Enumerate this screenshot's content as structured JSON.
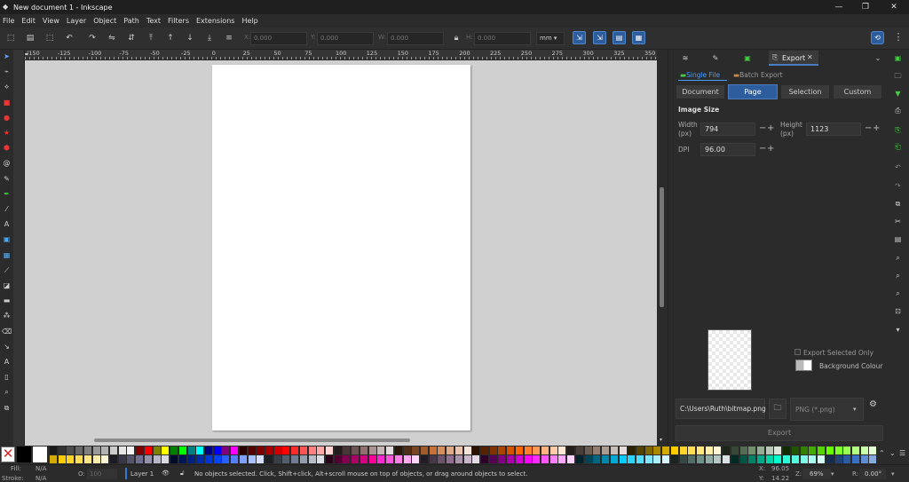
{
  "window": {
    "title": "New document 1 - Inkscape",
    "minimize": "—",
    "maximize": "❐",
    "close": "✕"
  },
  "menu": [
    "File",
    "Edit",
    "View",
    "Layer",
    "Object",
    "Path",
    "Text",
    "Filters",
    "Extensions",
    "Help"
  ],
  "toolbar": {
    "x_label": "X:",
    "x_value": "0.000",
    "y_label": "Y:",
    "y_value": "0.000",
    "w_label": "W:",
    "w_value": "0.000",
    "h_label": "H:",
    "h_value": "0.000",
    "unit": "mm"
  },
  "ruler": {
    "labels": [
      "-150",
      "-125",
      "-100",
      "-75",
      "-50",
      "-25",
      "0",
      "25",
      "50",
      "75",
      "100",
      "125",
      "150",
      "175",
      "200",
      "225",
      "250",
      "275",
      "300",
      "325",
      "350"
    ]
  },
  "panel": {
    "tab_export": "Export",
    "single_file": "Single File",
    "batch_export": "Batch Export",
    "area_buttons": [
      "Document",
      "Page",
      "Selection",
      "Custom"
    ],
    "image_size": "Image Size",
    "width_label": "Width (px)",
    "width_value": "794",
    "height_label": "Height (px)",
    "height_value": "1123",
    "dpi_label": "DPI",
    "dpi_value": "96.00",
    "export_selected_only": "Export Selected Only",
    "background_colour": "Background Colour",
    "filename": "C:\\Users\\Ruth\\bitmap.png",
    "format": "PNG (*.png)",
    "export_button": "Export"
  },
  "status": {
    "fill_label": "Fill:",
    "fill_value": "N/A",
    "stroke_label": "Stroke:",
    "stroke_value": "N/A",
    "opacity_label": "O:",
    "opacity_value": "100",
    "layer": "Layer 1",
    "message": "No objects selected. Click, Shift+click, Alt+scroll mouse on top of objects, or drag around objects to select.",
    "x_label": "X:",
    "x_value": "96.05",
    "y_label": "Y:",
    "y_value": "14.22",
    "z_label": "Z:",
    "zoom": "69%",
    "r_label": "R:",
    "rotation": "0.00°"
  },
  "colors": {
    "accent": "#2e5d9e",
    "canvas": "#d0d0d0",
    "ui_bg": "#2b2b2b"
  }
}
